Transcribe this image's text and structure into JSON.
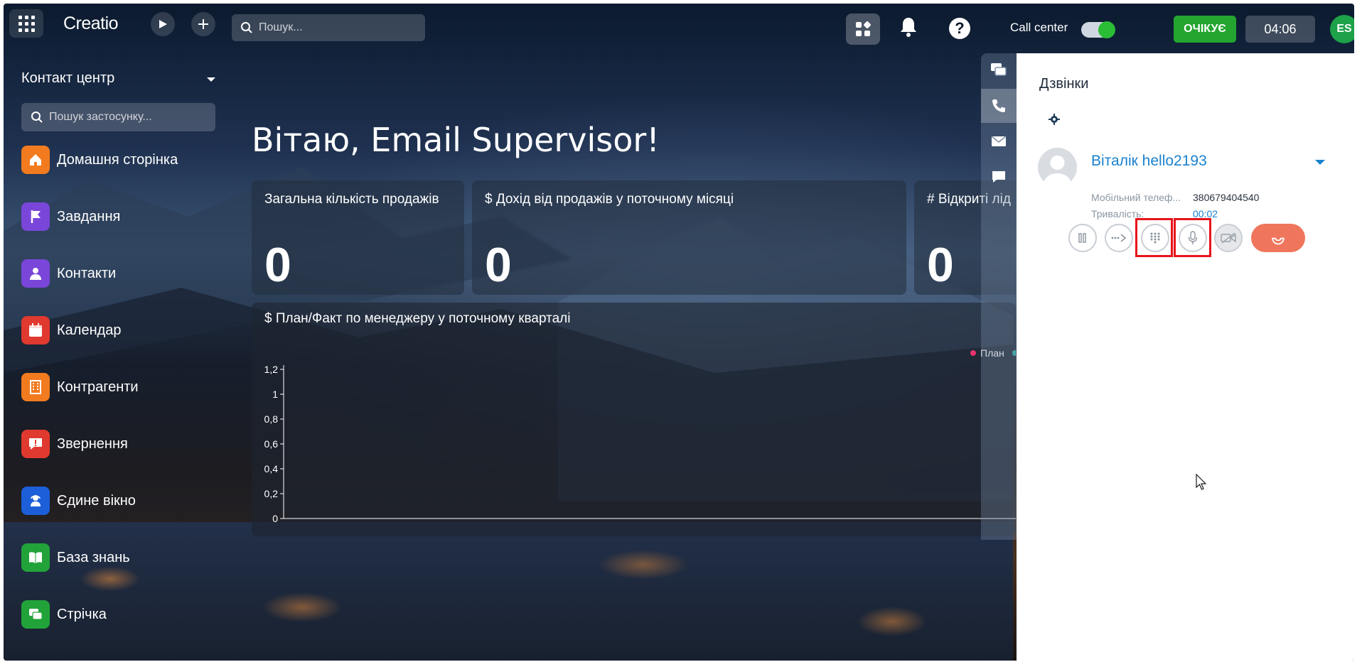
{
  "app": {
    "logo_text": "Creatio",
    "search_placeholder": "Пошук..."
  },
  "header": {
    "callcenter_label": "Call center",
    "callcenter_enabled": true,
    "status": "ОЧІКУЄ",
    "timer": "04:06",
    "user_initials": "ES"
  },
  "sidebar": {
    "section": "Контакт центр",
    "search_placeholder": "Пошук застосунку...",
    "items": [
      {
        "label": "Домашня сторінка",
        "icon": "home-icon",
        "color": "#f27b1f"
      },
      {
        "label": "Завдання",
        "icon": "flag-icon",
        "color": "#7a46d9"
      },
      {
        "label": "Контакти",
        "icon": "person-icon",
        "color": "#7a46d9"
      },
      {
        "label": "Календар",
        "icon": "calendar-icon",
        "color": "#e0392f"
      },
      {
        "label": "Контрагенти",
        "icon": "building-icon",
        "color": "#f27b1f"
      },
      {
        "label": "Звернення",
        "icon": "alert-chat-icon",
        "color": "#e0392f"
      },
      {
        "label": "Єдине вікно",
        "icon": "agent-icon",
        "color": "#1c5fd9"
      },
      {
        "label": "База знань",
        "icon": "book-icon",
        "color": "#22a33a"
      },
      {
        "label": "Стрічка",
        "icon": "feed-icon",
        "color": "#22a33a"
      }
    ]
  },
  "dashboard": {
    "greeting": "Вітаю, Email Supervisor!",
    "cards": [
      {
        "title": "Загальна кількість продажів",
        "value": "0"
      },
      {
        "title": "$ Дохід від продажів у поточному місяці",
        "value": "0"
      },
      {
        "title": "# Відкриті лід",
        "value": "0"
      }
    ],
    "chart_title": "$ План/Факт по менеджеру у поточному кварталі"
  },
  "chart_data": {
    "type": "bar",
    "title": "$ План/Факт по менеджеру у поточному кварталі",
    "categories": [],
    "series": [
      {
        "name": "План",
        "values": []
      }
    ],
    "y_ticks": [
      "0",
      "0,2",
      "0,4",
      "0,6",
      "0,8",
      "1",
      "1,2"
    ],
    "ylim": [
      0,
      1.2
    ],
    "legend": "top-right",
    "series_colors": [
      "#e8336f"
    ]
  },
  "call_panel": {
    "title": "Дзвінки",
    "contact_name": "Віталік hello2193",
    "phone_label": "Мобільний телеф...",
    "phone_value": "380679404540",
    "duration_label": "Тривалість:",
    "duration_value": "00:02",
    "controls": [
      "pause-icon",
      "transfer-icon",
      "dialpad-icon",
      "microphone-icon",
      "video-off-icon",
      "hangup-icon"
    ]
  }
}
